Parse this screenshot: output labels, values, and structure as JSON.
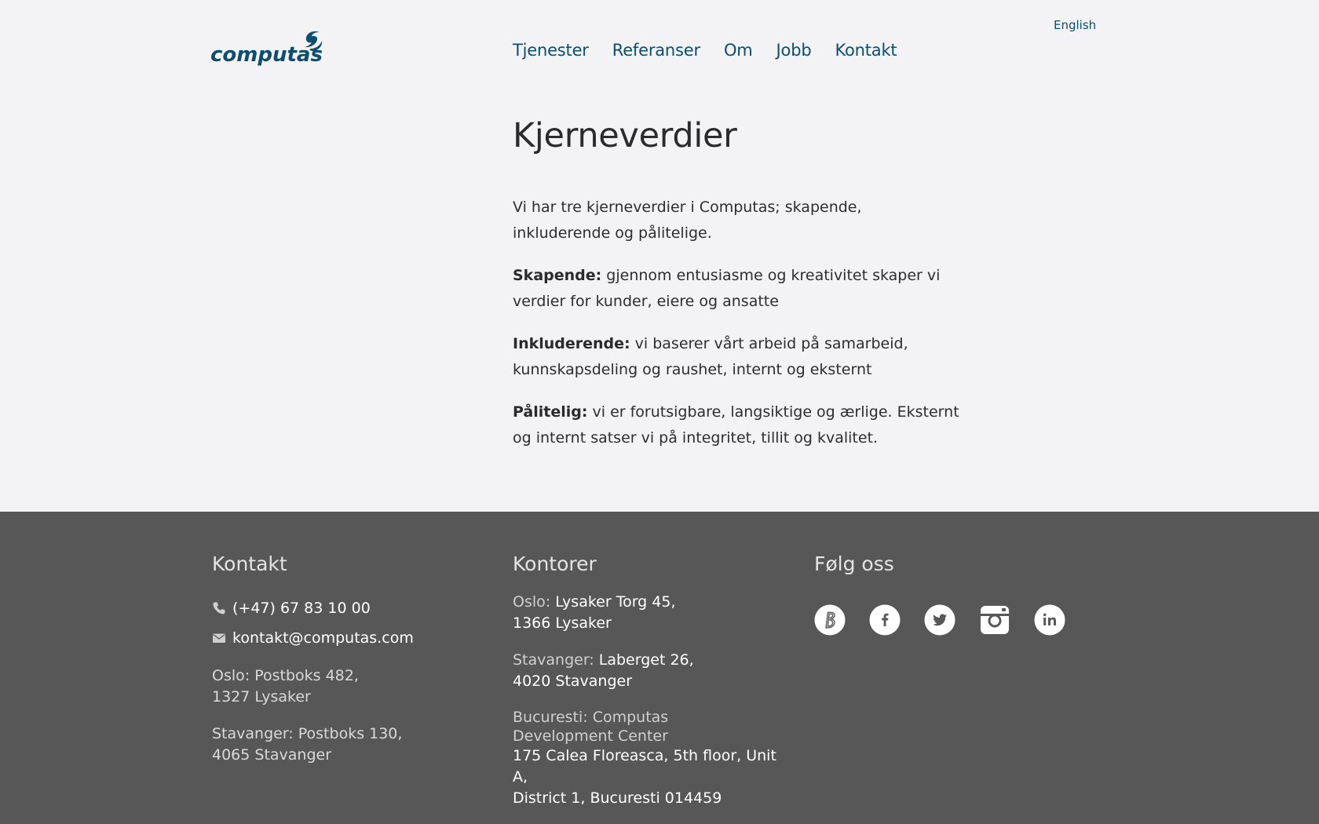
{
  "header": {
    "logo_text": "computas",
    "nav": [
      "Tjenester",
      "Referanser",
      "Om",
      "Jobb",
      "Kontakt"
    ],
    "language_link": "English"
  },
  "main": {
    "title": "Kjerneverdier",
    "intro": "Vi har tre kjerneverdier i Computas; skapende, inkluderende og pålitelige.",
    "values": [
      {
        "label": "Skapende:",
        "text": " gjennom entusiasme og kreativitet skaper vi verdier for kunder, eiere og ansatte"
      },
      {
        "label": "Inkluderende:",
        "text": " vi baserer vårt arbeid på samarbeid, kunnskapsdeling og raushet, internt og eksternt"
      },
      {
        "label": "Pålitelig:",
        "text": " vi er forutsigbare, langsiktige og ærlige. Eksternt og internt satser vi på integritet, tillit og kvalitet."
      }
    ]
  },
  "footer": {
    "kontakt": {
      "title": "Kontakt",
      "phone": "(+47) 67 83 10 00",
      "email": "kontakt@computas.com",
      "addresses": [
        [
          "Oslo: Postboks 482,",
          "1327 Lysaker"
        ],
        [
          "Stavanger: Postboks 130,",
          "4065 Stavanger"
        ]
      ]
    },
    "kontorer": {
      "title": "Kontorer",
      "offices": [
        {
          "city": "Oslo: ",
          "lines": [
            "Lysaker Torg 45,",
            "1366 Lysaker"
          ]
        },
        {
          "city": "Stavanger: ",
          "lines": [
            "Laberget 26,",
            "4020 Stavanger"
          ]
        },
        {
          "city": "Bucuresti: Computas Development Center",
          "lines": [
            "175 Calea Floreasca, 5th floor, Unit A,",
            "District 1, Bucuresti 014459"
          ]
        }
      ]
    },
    "folg_oss": {
      "title": "Følg oss",
      "icons": [
        "blog-icon",
        "facebook-icon",
        "twitter-icon",
        "instagram-icon",
        "linkedin-icon"
      ]
    }
  },
  "colors": {
    "background": "#f3f3f5",
    "brand_blue": "#0d4d6e",
    "footer_bg": "#575757",
    "body_text": "#2d2d2d"
  }
}
